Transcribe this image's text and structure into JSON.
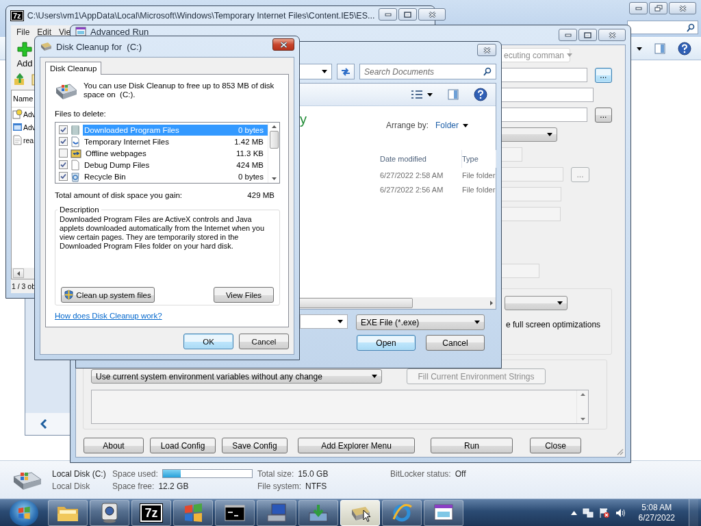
{
  "explorer": {
    "details": {
      "drive_name": "Local Disk (C:)",
      "drive_type": "Local Disk",
      "space_used": {
        "label": "Space used:",
        "level": 0.2
      },
      "space_free": {
        "label": "Space free:",
        "value": "12.2 GB"
      },
      "total_size": {
        "label": "Total size:",
        "value": "15.0 GB"
      },
      "file_system": {
        "label": "File system:",
        "value": "NTFS"
      },
      "bitlocker": {
        "label": "BitLocker status:",
        "value": "Off"
      }
    }
  },
  "sevenzip": {
    "logo": "7z",
    "title": "C:\\Users\\vm1\\AppData\\Local\\Microsoft\\Windows\\Temporary Internet Files\\Content.IE5\\ES...",
    "menu": [
      "File",
      "Edit",
      "Vie"
    ],
    "add_button": "Add",
    "column": "Name",
    "items": [
      {
        "name": "Adv",
        "kind": "help"
      },
      {
        "name": "Adv",
        "kind": "app"
      },
      {
        "name": "rea",
        "kind": "text"
      }
    ],
    "status": "1 / 3 ob"
  },
  "advanced_run": {
    "title": "Advanced Run",
    "rows": [
      {
        "kind": "dropdown",
        "value": "ecuting comman",
        "disabled": true
      },
      {
        "kind": "field",
        "disabled": false,
        "browse": {
          "label": "...",
          "focused": true,
          "disabled": false
        }
      },
      {
        "kind": "field",
        "disabled": false
      },
      {
        "kind": "field",
        "disabled": false,
        "browse": {
          "label": "...",
          "focused": false,
          "disabled": false
        }
      },
      {
        "kind": "dropdown",
        "disabled": false
      },
      {
        "kind": "field",
        "disabled": true
      },
      {
        "kind": "field",
        "disabled": true,
        "browse": {
          "label": "...",
          "focused": false,
          "disabled": true
        }
      },
      {
        "kind": "field",
        "disabled": true
      },
      {
        "kind": "field",
        "disabled": true
      },
      {
        "kind": "field",
        "disabled": true
      }
    ],
    "option_label": "e full screen optimizations",
    "env_dropdown": "Use current system environment variables without any change",
    "fill_button": {
      "label": "Fill Current Environment Strings",
      "disabled": true
    },
    "buttons": [
      "About",
      "Load Config",
      "Save Config",
      "Add Explorer Menu",
      "Run",
      "Close"
    ]
  },
  "open_dialog": {
    "search_placeholder": "Search Documents",
    "library_title": "y",
    "arrange_label": "Arrange by:",
    "arrange_value": "Folder",
    "columns": [
      "Date modified",
      "Type"
    ],
    "rows": [
      {
        "date": "6/27/2022 2:58 AM",
        "type": "File folder"
      },
      {
        "date": "6/27/2022 2:56 AM",
        "type": "File folder"
      }
    ],
    "file_type": "EXE File (*.exe)",
    "buttons": [
      {
        "label": "Open",
        "default": true
      },
      {
        "label": "Cancel",
        "default": false
      }
    ]
  },
  "disk_cleanup": {
    "title": "Disk Cleanup for  (C:)",
    "tab": "Disk Cleanup",
    "intro": "You can use Disk Cleanup to free up to 853 MB of disk space on  (C:).",
    "files_label": "Files to delete:",
    "files": [
      {
        "name": "Downloaded Program Files",
        "size": "0 bytes",
        "kind": "folder",
        "checked": true,
        "selected": true
      },
      {
        "name": "Temporary Internet Files",
        "size": "1.42 MB",
        "kind": "document",
        "checked": true,
        "selected": false
      },
      {
        "name": "Offline webpages",
        "size": "11.3 KB",
        "kind": "sync",
        "checked": false,
        "selected": false
      },
      {
        "name": "Debug Dump Files",
        "size": "424 MB",
        "kind": "blank",
        "checked": true,
        "selected": false
      },
      {
        "name": "Recycle Bin",
        "size": "0 bytes",
        "kind": "recycle",
        "checked": true,
        "selected": false
      }
    ],
    "total_label": "Total amount of disk space you gain:",
    "total": "429 MB",
    "description_title": "Description",
    "description": "Downloaded Program Files are ActiveX controls and Java applets downloaded automatically from the Internet when you view certain pages. They are temporarily stored in the Downloaded Program Files folder on your hard disk.",
    "cleanup_button": "Clean up system files",
    "view_button": "View Files",
    "help_link": "How does Disk Cleanup work?",
    "buttons": [
      {
        "label": "OK",
        "default": true
      },
      {
        "label": "Cancel",
        "default": false
      }
    ]
  },
  "taskbar": {
    "apps": [
      {
        "kind": "folder",
        "selected": false
      },
      {
        "kind": "media",
        "selected": false
      },
      {
        "kind": "archive",
        "label": "7z",
        "selected": false
      },
      {
        "kind": "windows",
        "selected": false
      },
      {
        "kind": "terminal",
        "selected": false
      },
      {
        "kind": "computer",
        "selected": false
      },
      {
        "kind": "download",
        "selected": false
      },
      {
        "kind": "drive",
        "selected": true
      },
      {
        "kind": "browser",
        "selected": false
      },
      {
        "kind": "window",
        "selected": false
      }
    ],
    "time": "5:08 AM",
    "date": "6/27/2022"
  }
}
